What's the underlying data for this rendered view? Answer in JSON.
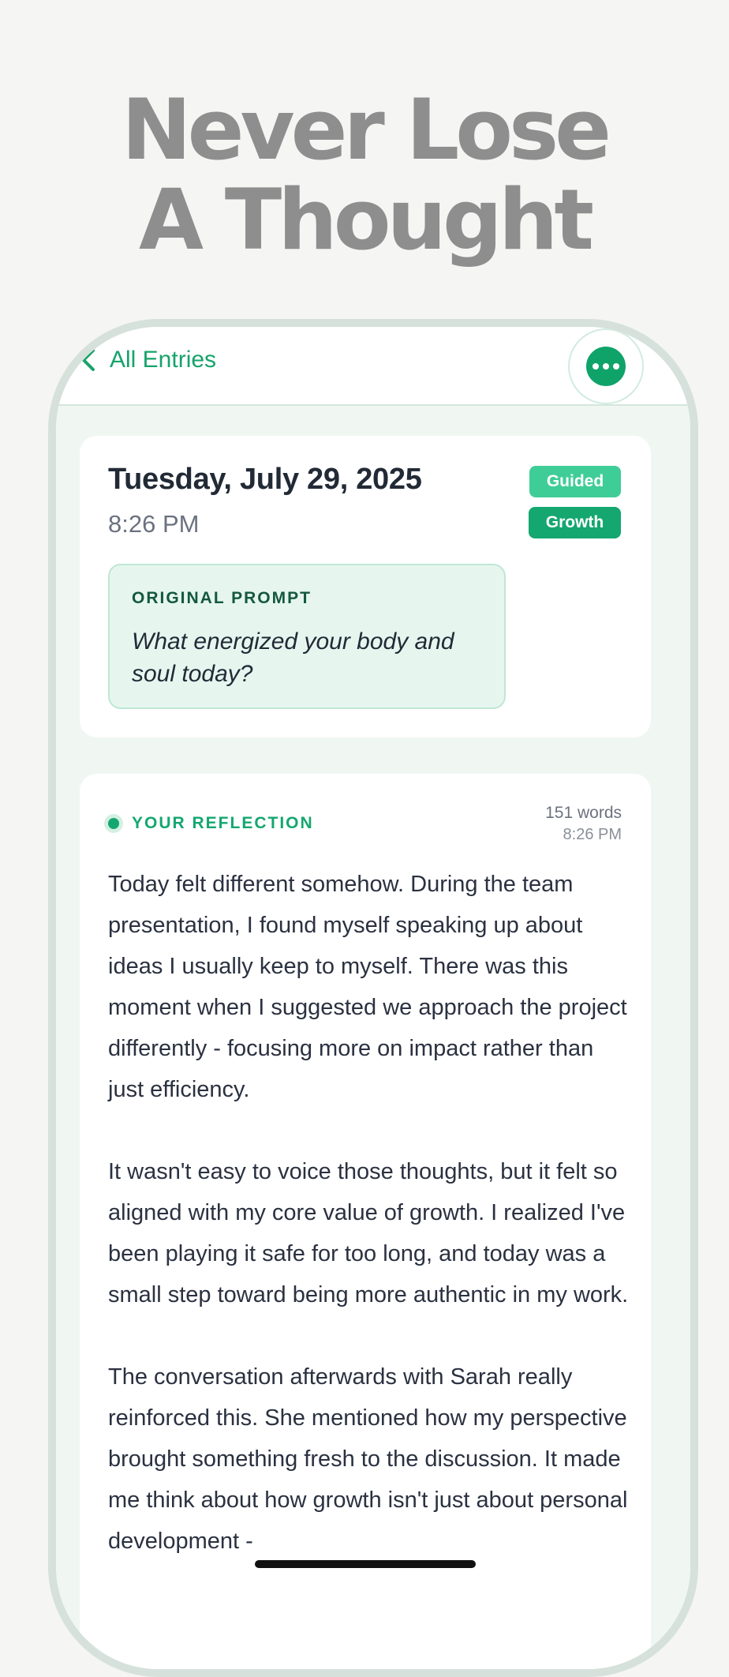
{
  "hero": {
    "line1": "Never Lose",
    "line2": "A Thought"
  },
  "navbar": {
    "back_label": "All Entries",
    "back_icon": "chevron-left-icon",
    "more_icon": "ellipsis-icon"
  },
  "entry": {
    "date": "Tuesday, July 29, 2025",
    "time": "8:26 PM",
    "badges": [
      "Guided",
      "Growth"
    ],
    "prompt_label": "ORIGINAL PROMPT",
    "prompt_text": "What energized your body and soul today?"
  },
  "reflection": {
    "label": "YOUR REFLECTION",
    "word_count": "151 words",
    "time": "8:26 PM",
    "paragraphs": [
      "Today felt different somehow. During the team presentation, I found myself speaking up about ideas I usually keep to myself. There was this moment when I suggested we approach the project differently - focusing more on impact rather than just efficiency.",
      "It wasn't easy to voice those thoughts, but it felt so aligned with my core value of growth. I realized I've been playing it safe for too long, and today was a small step toward being more authentic in my work.",
      "The conversation afterwards with Sarah really reinforced this. She mentioned how my perspective brought something fresh to the discussion. It made me think about how growth isn't just about personal development -"
    ]
  },
  "colors": {
    "accent": "#14a76f",
    "background": "#f5f5f4",
    "hero_text": "#8e8e8e"
  }
}
